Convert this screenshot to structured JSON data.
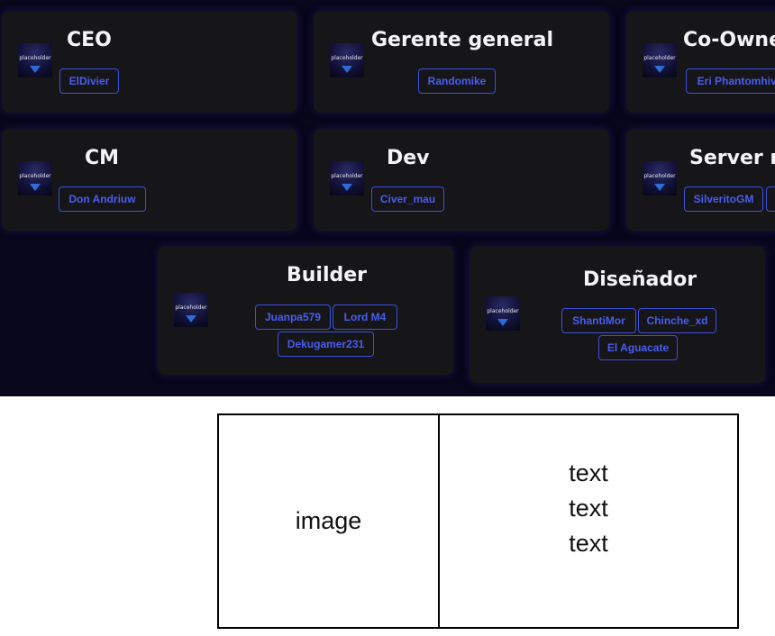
{
  "avatar_text": "placeholder",
  "roles": [
    {
      "title": "CEO",
      "members": [
        "ElDivier"
      ]
    },
    {
      "title": "Gerente general",
      "members": [
        "Randomike"
      ]
    },
    {
      "title": "Co-Owne",
      "members": [
        "Eri Phantomhive"
      ]
    },
    {
      "title": "CM",
      "members": [
        "Don Andriuw"
      ]
    },
    {
      "title": "Dev",
      "members": [
        "Civer_mau"
      ]
    },
    {
      "title": "Server m",
      "members": [
        "SilveritoGM",
        ""
      ]
    },
    {
      "title": "Builder",
      "members": [
        "Juanpa579",
        "Lord M4",
        "Dekugamer231"
      ]
    },
    {
      "title": "Diseñador",
      "members": [
        "ShantiMor",
        "Chinche_xd",
        "El Aguacate"
      ]
    }
  ],
  "wireframe": {
    "image_label": "image",
    "text_lines": [
      "text",
      "text",
      "text"
    ]
  },
  "colors": {
    "background": "#07061a",
    "card": "#161619",
    "chip_border": "#3b4fe0",
    "chip_text": "#4a5cf0",
    "title": "#f4f4f4"
  }
}
